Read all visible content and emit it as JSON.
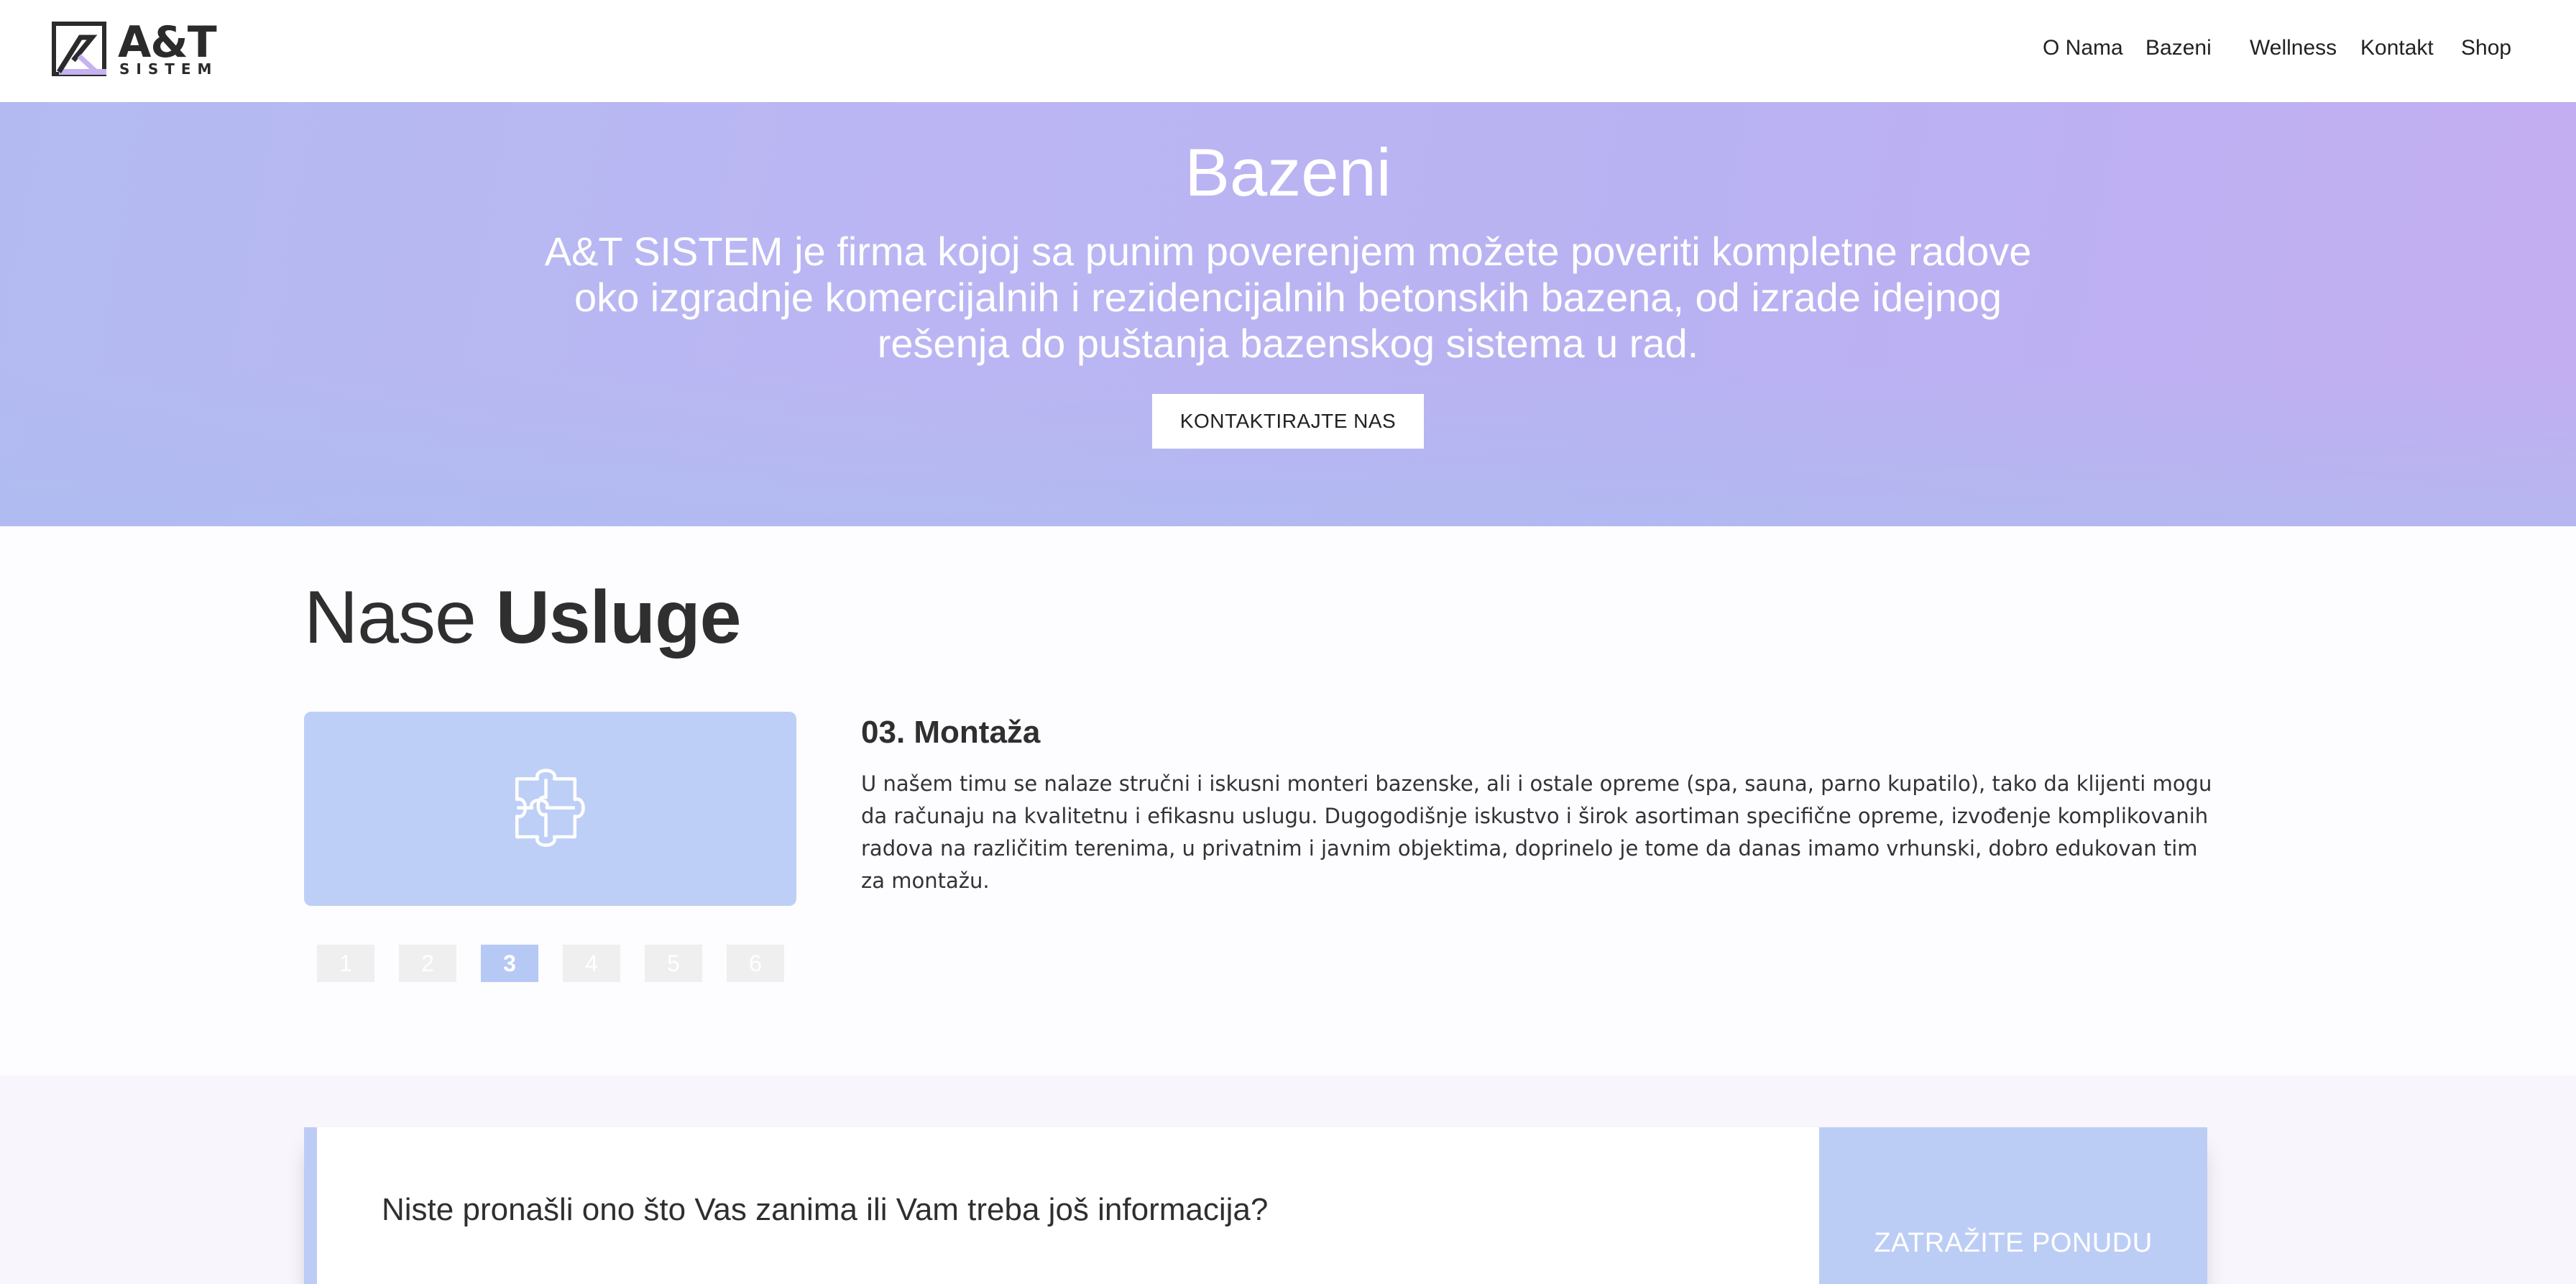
{
  "header": {
    "logo_main": "A&T",
    "logo_sub": "SISTEM",
    "nav": [
      "O Nama",
      "Bazeni",
      "Wellness",
      "Kontakt",
      "Shop"
    ]
  },
  "hero": {
    "title": "Bazeni",
    "text": "A&T SISTEM je firma kojoj sa punim poverenjem možete poveriti kompletne radove oko izgradnje komercijalnih i rezidencijalnih betonskih bazena, od izrade idejnog rešenja do puštanja bazenskog sistema u rad.",
    "button_label": "KONTAKTIRAJTE NAS"
  },
  "services": {
    "heading_light": "Nase",
    "heading_bold": "Usluge",
    "active_item": {
      "icon": "puzzle-icon",
      "title": "03. Montaža",
      "text": "U našem timu se nalaze stručni i iskusni monteri bazenske, ali i ostale opreme (spa, sauna, parno kupatilo), tako da klijenti mogu da računaju na kvalitetnu i efikasnu uslugu. Dugogodišnje iskustvo i širok asortiman specifične opreme, izvođenje komplikovanih radova na različitim terenima, u privatnim i javnim objektima, doprinelo je tome da danas imamo vrhunski, dobro edukovan tim za montažu."
    },
    "pages": [
      "1",
      "2",
      "3",
      "4",
      "5",
      "6"
    ],
    "active_page": "3"
  },
  "cta": {
    "text": "Niste pronašli ono što Vas zanima ili Vam treba još informacija?",
    "button_label": "ZATRAŽITE PONUDU"
  },
  "colors": {
    "accent": "#bccdf5",
    "hero_start": "#b3baf2",
    "hero_end": "#c3aef1"
  }
}
